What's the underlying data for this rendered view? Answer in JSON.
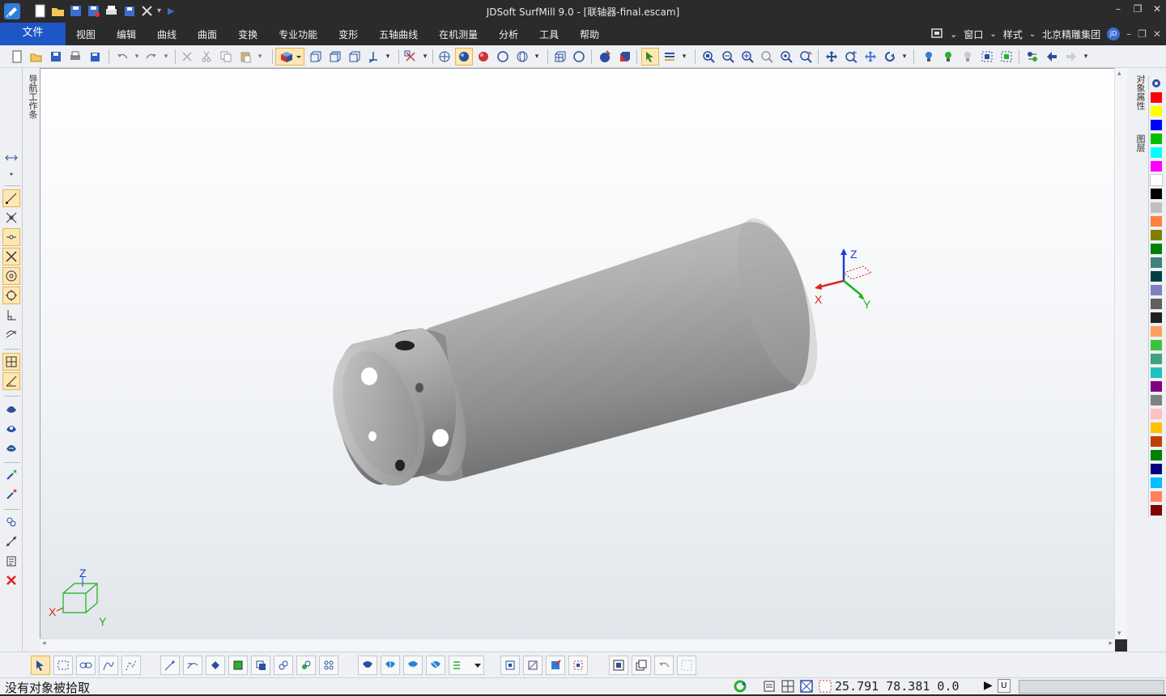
{
  "window": {
    "title": "JDSoft SurfMill 9.0 - [联轴器-final.escam]",
    "controls": {
      "minimize": "–",
      "restore": "❐",
      "close": "✕"
    }
  },
  "menubar": {
    "file_tab": "文件",
    "items": [
      "视图",
      "编辑",
      "曲线",
      "曲面",
      "变换",
      "专业功能",
      "变形",
      "五轴曲线",
      "在机测量",
      "分析",
      "工具",
      "帮助"
    ],
    "right": {
      "window_label": "窗口",
      "style_label": "样式",
      "company": "北京精雕集团",
      "badge": "JD"
    }
  },
  "panels": {
    "nav_label": "导航工作条",
    "object_props_label": "对象属性",
    "layers_label": "图层"
  },
  "viewport": {
    "axis_triad": {
      "x": "X",
      "y": "Y",
      "z": "Z"
    },
    "view_cube_axes": {
      "x": "X",
      "y": "Y",
      "z": "Z"
    }
  },
  "palette": {
    "colors": [
      "#ff0000",
      "#ffff00",
      "#0000ff",
      "#00c000",
      "#00ffff",
      "#ff00ff",
      "#ffffff",
      "#000000",
      "#c0c0c0",
      "#ff8040",
      "#808000",
      "#008000",
      "#408080",
      "#004040",
      "#8080c0",
      "#606060",
      "#202020",
      "#ffa060",
      "#40c040",
      "#40a080",
      "#20c0c0",
      "#800080",
      "#808080",
      "#ffc0c0",
      "#ffc000",
      "#c04000",
      "#008000",
      "#000080",
      "#00c0ff",
      "#ff8060",
      "#800000"
    ]
  },
  "status": {
    "message": "没有对象被拾取",
    "coords": "25.791  78.381  0.0",
    "u_label": "U"
  }
}
